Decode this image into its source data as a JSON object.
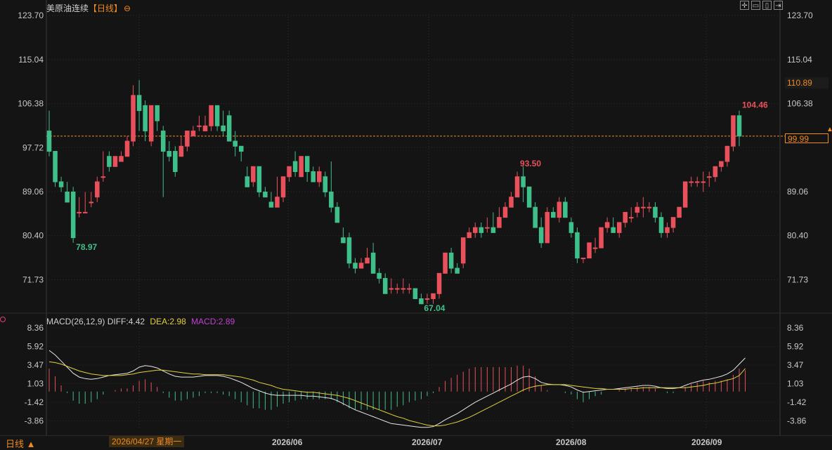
{
  "header": {
    "title": "美原油连续",
    "period_tag": "【日线】",
    "symbol_icon": "⊖",
    "toolbar_icons": [
      "crosshair-icon",
      "zoom-out-icon",
      "zoom-in-icon",
      "scroll-icon"
    ]
  },
  "price_axis": {
    "left_labels": [
      "123.70",
      "115.04",
      "106.38",
      "97.72",
      "89.06",
      "80.40",
      "71.73"
    ],
    "right_labels": [
      "123.70",
      "115.04",
      "106.38",
      "97.72",
      "89.06",
      "80.40",
      "71.73"
    ],
    "current_price": "99.99",
    "highlight_price": "110.89"
  },
  "annotations": {
    "low1": "78.97",
    "high1": "104.46",
    "high2": "93.50",
    "low2": "67.04"
  },
  "macd": {
    "label": "MACD(26,12,9)",
    "diff": "DIFF:4.42",
    "dea": "DEA:2.98",
    "macd": "MACD:2.89",
    "axis_labels": [
      "8.36",
      "5.92",
      "3.47",
      "1.03",
      "-1.42",
      "-3.86"
    ]
  },
  "bottom": {
    "period_button": "日线 ▲",
    "cursor_date": "2026/04/27 星期一",
    "dates": [
      "2026/06",
      "2026/07",
      "2026/08",
      "2026/09"
    ]
  },
  "colors": {
    "up": "#e8505b",
    "down": "#3fbf8a",
    "dif": "#e6e6e6",
    "dea": "#e3d13a",
    "accent": "#f08a1c"
  },
  "chart_data": {
    "type": "candlestick",
    "ylim": [
      66,
      124
    ],
    "macd_ylim": [
      -5,
      9
    ],
    "candles": [
      [
        101,
        105,
        97,
        96
      ],
      [
        97,
        97,
        91,
        90
      ],
      [
        91,
        92,
        90,
        89
      ],
      [
        89,
        91,
        87,
        87
      ],
      [
        89,
        90,
        80,
        79
      ],
      [
        85,
        88,
        85,
        84
      ],
      [
        85,
        89,
        85,
        85
      ],
      [
        87,
        89,
        87,
        86
      ],
      [
        88,
        92,
        91,
        87
      ],
      [
        92,
        97,
        92,
        91
      ],
      [
        96,
        97,
        94,
        93
      ],
      [
        94,
        96,
        96,
        94
      ],
      [
        95,
        97,
        96,
        95
      ],
      [
        96,
        100,
        99,
        96
      ],
      [
        99,
        110,
        108,
        98
      ],
      [
        108,
        111,
        105,
        101
      ],
      [
        106,
        107,
        101,
        99
      ],
      [
        99,
        106,
        106,
        98
      ],
      [
        106,
        106,
        103,
        101
      ],
      [
        101,
        102,
        97,
        88
      ],
      [
        97,
        99,
        96,
        95
      ],
      [
        97,
        98,
        93,
        92
      ],
      [
        96,
        100,
        98,
        96
      ],
      [
        98,
        101,
        101,
        97
      ],
      [
        100,
        102,
        101,
        100
      ],
      [
        102,
        104,
        102,
        101
      ],
      [
        101,
        104,
        102,
        101
      ],
      [
        102,
        106,
        106,
        101
      ],
      [
        106,
        106,
        102,
        101
      ],
      [
        102,
        105,
        101,
        100
      ],
      [
        104,
        105,
        99,
        99
      ],
      [
        99,
        101,
        98,
        96
      ],
      [
        98,
        98,
        97,
        95
      ],
      [
        92,
        94,
        90,
        90
      ],
      [
        91,
        94,
        94,
        90
      ],
      [
        94,
        94,
        89,
        88
      ],
      [
        89,
        90,
        88,
        88
      ],
      [
        87,
        89,
        86,
        86
      ],
      [
        86,
        92,
        88,
        86
      ],
      [
        88,
        92,
        92,
        87
      ],
      [
        92,
        94,
        94,
        91
      ],
      [
        95,
        97,
        93,
        92
      ],
      [
        92,
        96,
        96,
        92
      ],
      [
        96,
        96,
        93,
        91
      ],
      [
        93,
        94,
        91,
        91
      ],
      [
        91,
        94,
        93,
        90
      ],
      [
        92,
        93,
        89,
        88
      ],
      [
        89,
        95,
        86,
        85
      ],
      [
        86,
        87,
        83,
        83
      ],
      [
        80,
        82,
        79,
        79
      ],
      [
        80,
        81,
        75,
        74
      ],
      [
        75,
        76,
        74,
        73
      ],
      [
        74,
        76,
        75,
        74
      ],
      [
        75,
        78,
        76,
        75
      ],
      [
        77,
        79,
        73,
        73
      ],
      [
        73,
        74,
        72,
        71
      ],
      [
        72,
        73,
        69,
        69
      ],
      [
        70,
        72,
        70,
        69
      ],
      [
        70,
        71,
        70,
        69
      ],
      [
        70,
        72,
        70,
        69
      ],
      [
        70,
        71,
        70,
        69
      ],
      [
        70,
        70,
        68,
        68
      ],
      [
        68,
        69,
        67,
        67
      ],
      [
        68,
        69,
        68,
        67
      ],
      [
        68,
        69,
        69,
        67
      ],
      [
        69,
        73,
        73,
        68
      ],
      [
        73,
        77,
        77,
        73
      ],
      [
        77,
        78,
        74,
        73
      ],
      [
        74,
        75,
        73,
        73
      ],
      [
        75,
        80,
        80,
        74
      ],
      [
        80,
        82,
        81,
        80
      ],
      [
        81,
        83,
        82,
        80
      ],
      [
        82,
        83,
        81,
        80
      ],
      [
        82,
        84,
        82,
        81
      ],
      [
        82,
        85,
        81,
        81
      ],
      [
        82,
        86,
        84,
        82
      ],
      [
        84,
        87,
        86,
        84
      ],
      [
        86,
        89,
        88,
        86
      ],
      [
        88,
        93,
        92,
        88
      ],
      [
        92,
        94,
        90,
        87
      ],
      [
        90,
        90,
        86,
        86
      ],
      [
        86,
        87,
        82,
        82
      ],
      [
        82,
        84,
        79,
        78
      ],
      [
        79,
        86,
        85,
        79
      ],
      [
        85,
        86,
        84,
        84
      ],
      [
        84,
        88,
        87,
        83
      ],
      [
        87,
        88,
        84,
        84
      ],
      [
        83,
        84,
        81,
        80
      ],
      [
        81,
        82,
        76,
        75
      ],
      [
        76,
        76,
        76,
        75
      ],
      [
        76,
        79,
        79,
        76
      ],
      [
        78,
        80,
        78,
        77
      ],
      [
        78,
        82,
        82,
        78
      ],
      [
        82,
        84,
        83,
        81
      ],
      [
        82,
        84,
        81,
        81
      ],
      [
        81,
        83,
        83,
        80
      ],
      [
        83,
        85,
        85,
        82
      ],
      [
        84,
        86,
        84,
        83
      ],
      [
        85,
        87,
        86,
        84
      ],
      [
        86,
        88,
        86,
        84
      ],
      [
        86,
        87,
        86,
        85
      ],
      [
        86,
        87,
        84,
        83
      ],
      [
        84,
        85,
        81,
        80
      ],
      [
        81,
        83,
        82,
        80
      ],
      [
        82,
        84,
        84,
        81
      ],
      [
        84,
        86,
        86,
        84
      ],
      [
        86,
        91,
        91,
        86
      ],
      [
        91,
        92,
        91,
        90
      ],
      [
        91,
        92,
        91,
        90
      ],
      [
        91,
        93,
        91,
        89
      ],
      [
        92,
        93,
        92,
        90
      ],
      [
        92,
        94,
        94,
        91
      ],
      [
        94,
        95,
        95,
        93
      ],
      [
        95,
        98,
        98,
        94
      ],
      [
        98,
        104,
        104,
        97
      ],
      [
        104,
        105,
        100,
        98
      ]
    ],
    "macd_diff": [
      5.4,
      4.8,
      4.0,
      3.2,
      2.4,
      1.9,
      1.7,
      1.6,
      1.7,
      1.9,
      2.1,
      2.2,
      2.3,
      2.4,
      2.7,
      3.2,
      3.4,
      3.3,
      3.1,
      2.7,
      2.3,
      2.0,
      1.9,
      1.9,
      1.9,
      2.0,
      2.1,
      2.1,
      2.1,
      2.0,
      1.8,
      1.5,
      1.2,
      0.8,
      0.4,
      0.1,
      -0.2,
      -0.4,
      -0.5,
      -0.5,
      -0.5,
      -0.5,
      -0.5,
      -0.6,
      -0.6,
      -0.7,
      -0.8,
      -0.9,
      -1.2,
      -1.6,
      -2.0,
      -2.4,
      -2.7,
      -3.0,
      -3.3,
      -3.6,
      -3.9,
      -4.2,
      -4.3,
      -4.4,
      -4.5,
      -4.6,
      -4.7,
      -4.7,
      -4.6,
      -4.2,
      -3.7,
      -3.3,
      -2.9,
      -2.4,
      -1.9,
      -1.4,
      -1.0,
      -0.6,
      -0.2,
      0.2,
      0.6,
      1.0,
      1.5,
      1.9,
      2.0,
      1.7,
      1.2,
      1.0,
      0.9,
      0.9,
      0.8,
      0.6,
      0.2,
      -0.1,
      0.0,
      0.1,
      0.2,
      0.3,
      0.3,
      0.4,
      0.5,
      0.6,
      0.7,
      0.8,
      0.8,
      0.7,
      0.5,
      0.4,
      0.4,
      0.5,
      0.8,
      1.1,
      1.3,
      1.5,
      1.6,
      1.8,
      2.0,
      2.3,
      2.8,
      3.6,
      4.4
    ],
    "macd_dea": [
      3.9,
      3.8,
      3.6,
      3.3,
      3.0,
      2.7,
      2.5,
      2.3,
      2.2,
      2.1,
      2.1,
      2.1,
      2.1,
      2.2,
      2.3,
      2.5,
      2.6,
      2.7,
      2.8,
      2.8,
      2.7,
      2.6,
      2.5,
      2.4,
      2.3,
      2.3,
      2.2,
      2.2,
      2.2,
      2.2,
      2.1,
      2.0,
      1.9,
      1.7,
      1.5,
      1.2,
      1.0,
      0.8,
      0.5,
      0.3,
      0.2,
      0.1,
      0.0,
      -0.1,
      -0.1,
      -0.2,
      -0.3,
      -0.4,
      -0.5,
      -0.7,
      -0.9,
      -1.2,
      -1.5,
      -1.8,
      -2.1,
      -2.4,
      -2.7,
      -3.0,
      -3.3,
      -3.5,
      -3.8,
      -4.0,
      -4.2,
      -4.4,
      -4.5,
      -4.5,
      -4.4,
      -4.2,
      -4.0,
      -3.7,
      -3.4,
      -3.0,
      -2.6,
      -2.2,
      -1.8,
      -1.4,
      -1.0,
      -0.6,
      -0.2,
      0.2,
      0.5,
      0.7,
      0.8,
      0.9,
      0.9,
      0.9,
      0.9,
      0.8,
      0.7,
      0.6,
      0.5,
      0.4,
      0.4,
      0.3,
      0.3,
      0.3,
      0.3,
      0.4,
      0.4,
      0.5,
      0.5,
      0.5,
      0.5,
      0.5,
      0.5,
      0.5,
      0.5,
      0.6,
      0.7,
      0.8,
      1.0,
      1.1,
      1.3,
      1.5,
      1.7,
      2.1,
      3.0
    ]
  }
}
